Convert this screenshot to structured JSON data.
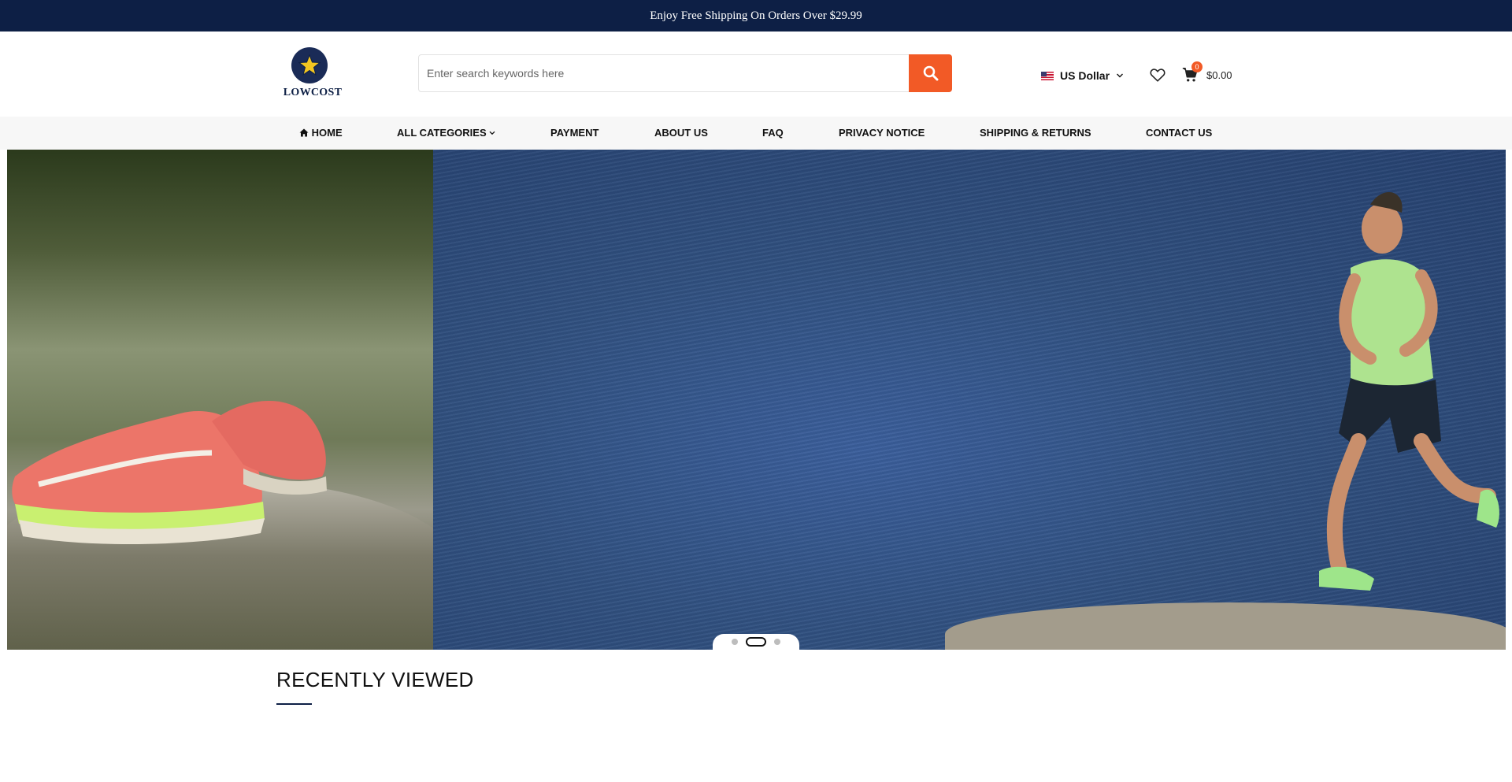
{
  "promo": {
    "text": "Enjoy Free Shipping On Orders Over $29.99"
  },
  "header": {
    "logo_text": "LOWCOST",
    "search": {
      "placeholder": "Enter search keywords here",
      "button_icon": "search-icon"
    },
    "currency": {
      "label": "US Dollar",
      "flag_icon": "us-flag-icon"
    },
    "wishlist_icon": "heart-icon",
    "cart": {
      "count": "0",
      "total": "$0.00",
      "icon": "cart-icon"
    }
  },
  "nav": {
    "items": [
      {
        "label": "HOME",
        "icon": "home-icon"
      },
      {
        "label": "ALL CATEGORIES",
        "icon": "chevron-down-icon"
      },
      {
        "label": "PAYMENT"
      },
      {
        "label": "ABOUT US"
      },
      {
        "label": "FAQ"
      },
      {
        "label": "PRIVACY NOTICE"
      },
      {
        "label": "SHIPPING & RETURNS"
      },
      {
        "label": "CONTACT US"
      }
    ]
  },
  "hero": {
    "slide_count": 3,
    "active_slide": 2
  },
  "recently_viewed": {
    "title": "RECENTLY VIEWED"
  },
  "colors": {
    "navy": "#0d1f45",
    "accent": "#f25a26",
    "nav_bg": "#f7f7f7"
  }
}
